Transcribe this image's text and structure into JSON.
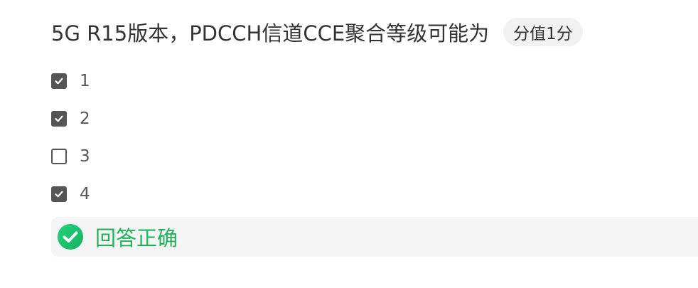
{
  "question": {
    "title": "5G R15版本，PDCCH信道CCE聚合等级可能为",
    "score": "分值1分",
    "options": [
      {
        "label": "1",
        "checked": true
      },
      {
        "label": "2",
        "checked": true
      },
      {
        "label": "3",
        "checked": false
      },
      {
        "label": "4",
        "checked": true
      }
    ]
  },
  "result": {
    "text": "回答正确",
    "icon": "check-circle-icon",
    "color": "#1fb45a"
  }
}
